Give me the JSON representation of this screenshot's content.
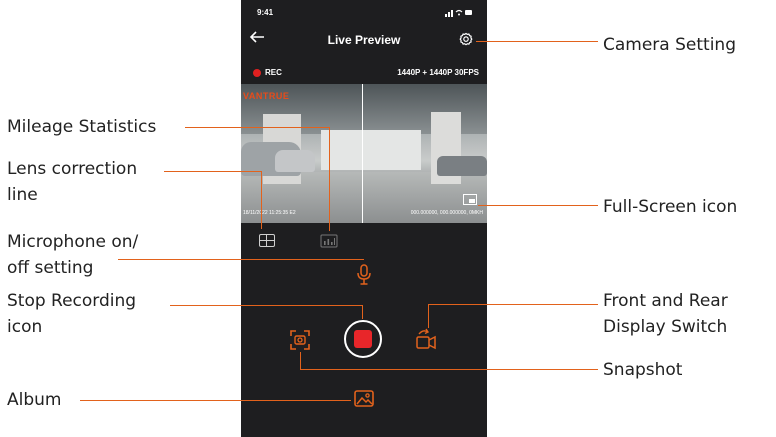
{
  "phone": {
    "status_time": "9:41",
    "status_icons": "signal-wifi-battery",
    "nav_title": "Live Preview",
    "back_icon": "back-arrow-icon",
    "settings_icon": "gear-icon",
    "rec_label": "REC",
    "resolution": "1440P + 1440P 30FPS",
    "video": {
      "brand_overlay": "VANTRUE",
      "timestamp": "18/11/2022 11:25:35 E2",
      "gps_readout": "000.000000, 000.000000, 0MKH"
    },
    "accent_color": "#e2621c",
    "record_color": "#e8262a"
  },
  "callouts": {
    "camera_setting": "Camera Setting",
    "mileage_statistics": "Mileage Statistics",
    "lens_correction_line_1": "Lens correction",
    "lens_correction_line_2": "line",
    "full_screen_icon": "Full-Screen icon",
    "microphone_line_1": "Microphone on/",
    "microphone_line_2": "off setting",
    "stop_recording_line_1": "Stop Recording",
    "stop_recording_line_2": "icon",
    "front_rear_line_1": "Front and Rear",
    "front_rear_line_2": "Display Switch",
    "snapshot": "Snapshot",
    "album": "Album"
  }
}
